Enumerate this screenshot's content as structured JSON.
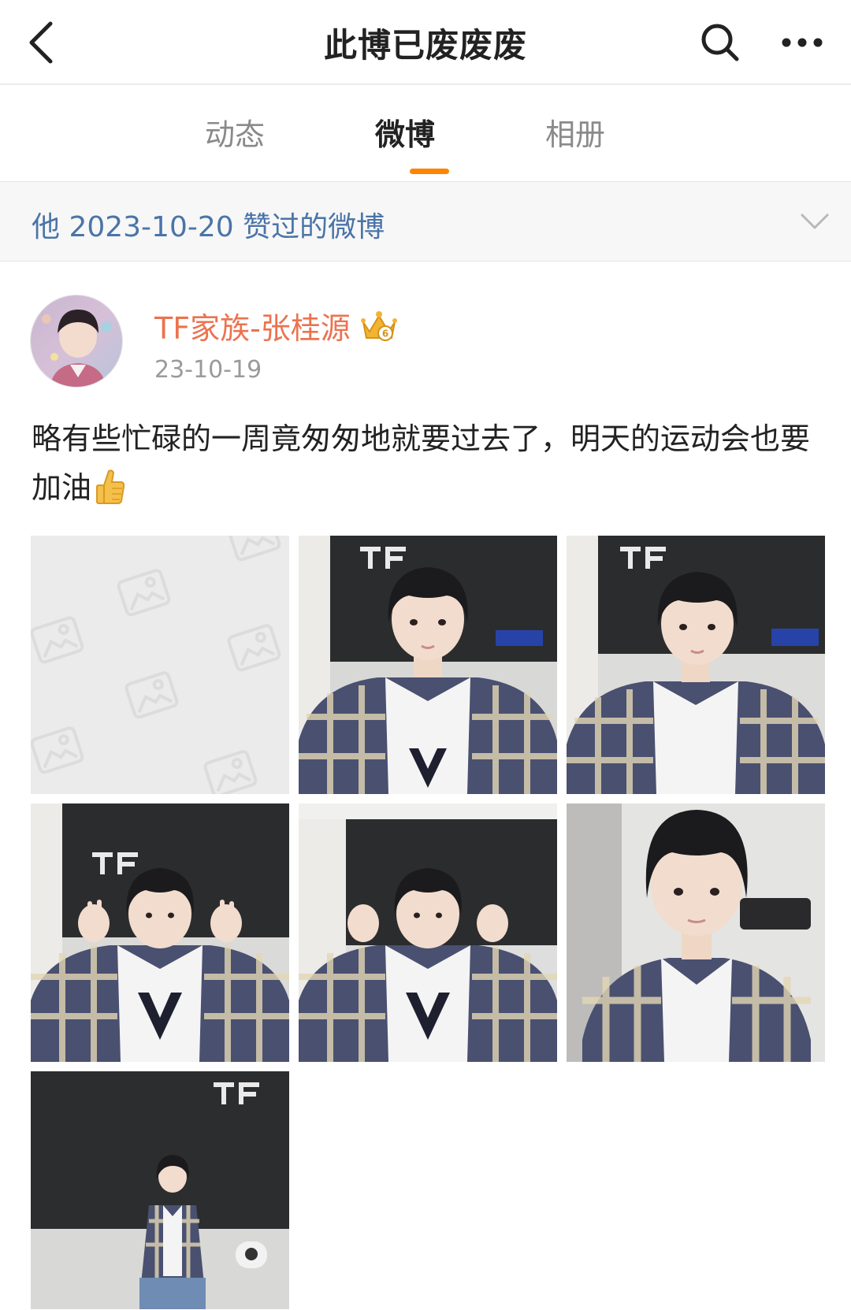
{
  "header": {
    "title": "此博已废废废"
  },
  "tabs": [
    {
      "label": "动态",
      "active": false
    },
    {
      "label": "微博",
      "active": true
    },
    {
      "label": "相册",
      "active": false
    }
  ],
  "filter": {
    "text": "他 2023-10-20 赞过的微博"
  },
  "post": {
    "author": "TF家族-张桂源",
    "date": "23-10-19",
    "text": "略有些忙碌的一周竟匆匆地就要过去了，明天的运动会也要加油",
    "emoji": "thumbs-up-emoji",
    "photos": [
      {
        "state": "placeholder"
      },
      {
        "state": "loaded",
        "icon": "photo-image"
      },
      {
        "state": "loaded",
        "icon": "photo-image"
      },
      {
        "state": "loaded",
        "icon": "photo-image"
      },
      {
        "state": "loaded",
        "icon": "photo-image"
      },
      {
        "state": "loaded",
        "icon": "photo-image"
      },
      {
        "state": "loaded",
        "icon": "photo-image"
      }
    ]
  },
  "colors": {
    "accent": "#ff8200",
    "author_name": "#eb7350",
    "filter_text": "#4a74a8"
  }
}
